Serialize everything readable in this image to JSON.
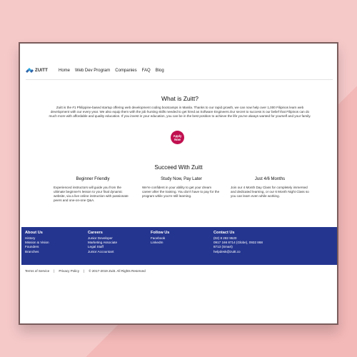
{
  "nav": {
    "logo_text": "ZUITT",
    "items": [
      "Home",
      "Web Dev Program",
      "Companies",
      "FAQ",
      "Blog"
    ]
  },
  "about": {
    "title": "What is Zuitt?",
    "body": "Zuitt is the #1 Philippine-based startup offering web development coding bootcamps in Manila. Thanks to our rapid growth, we can now help over 1,000 Filipinos learn web development with our every year. We also equip them with the job hunting skills needed to get hired as Software Engineers.Our secret to success is our belief that Filipinos can do much more with affordable and quality education. If you invest in your education, you can be in the best position to achieve the life you've always wanted for yourself and your family.",
    "apply_line1": "Apply",
    "apply_line2": "Now"
  },
  "succeed": {
    "title": "Succeed With Zuitt",
    "features": [
      {
        "title": "Beginner Friendly",
        "text": "Experienced instructors will guide you from the ultimate beginner's lesson to your final dynamic website, via a live online instruction with passionate peers and one-on-one Q&A."
      },
      {
        "title": "Study Now, Pay Later",
        "text": "We're confident in your ability to get your dream career after the training. You don't have to pay for the program while you're still learning."
      },
      {
        "title": "Just 4/6 Months",
        "text": "Join our 4 Month Day Class for completely immersed and dedicated learning, or our 6 Month Night Class so you can learn even while working."
      }
    ]
  },
  "footer": {
    "about": {
      "title": "About Us",
      "items": [
        "History",
        "Mission & Vision",
        "Founders",
        "Branches"
      ]
    },
    "careers": {
      "title": "Careers",
      "items": [
        "Junior Developer",
        "Marketing Associate",
        "Legal Staff",
        "Junior Accountant"
      ]
    },
    "follow": {
      "title": "Follow Us",
      "items": [
        "Facebook",
        "LinkedIn"
      ]
    },
    "contact": {
      "title": "Contact Us",
      "items": [
        "(02) 8 282 9520",
        "0917 166 8714 (Globe), 0932 868",
        "8713 (Smart)",
        "helpdesk@zuitt.co"
      ]
    }
  },
  "bottom": {
    "terms": "Terms of Service",
    "sep": "|",
    "privacy": "Privacy Policy",
    "copyright": "© 2017-2019 Zuitt. All Rights Reserved"
  },
  "colors": {
    "footer_bg": "#24358f",
    "apply_btn": "#c0104f",
    "background": "#f6c9c9"
  }
}
